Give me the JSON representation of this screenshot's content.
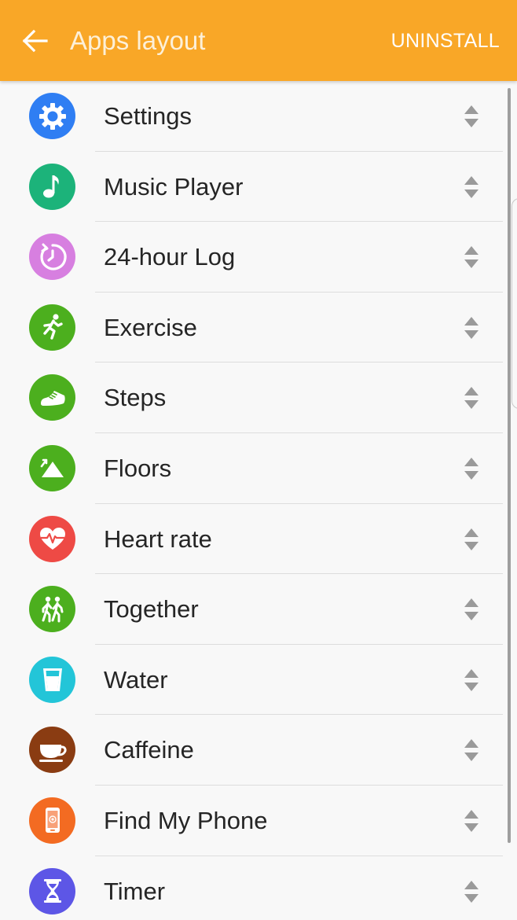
{
  "header": {
    "title": "Apps layout",
    "action_label": "UNINSTALL",
    "back_icon": "arrow-left-icon",
    "background_color": "#f9a727"
  },
  "apps": [
    {
      "label": "Settings",
      "icon": "gear-icon",
      "color": "#2f7ef3"
    },
    {
      "label": "Music Player",
      "icon": "music-note-icon",
      "color": "#1cb37a"
    },
    {
      "label": "24-hour Log",
      "icon": "clock-log-icon",
      "color": "#d77fe0"
    },
    {
      "label": "Exercise",
      "icon": "runner-icon",
      "color": "#4caf1e"
    },
    {
      "label": "Steps",
      "icon": "shoe-icon",
      "color": "#4caf1e"
    },
    {
      "label": "Floors",
      "icon": "mountain-icon",
      "color": "#4caf1e"
    },
    {
      "label": "Heart rate",
      "icon": "heart-pulse-icon",
      "color": "#ee4a45"
    },
    {
      "label": "Together",
      "icon": "walkers-icon",
      "color": "#4caf1e"
    },
    {
      "label": "Water",
      "icon": "glass-icon",
      "color": "#23c5d8"
    },
    {
      "label": "Caffeine",
      "icon": "coffee-cup-icon",
      "color": "#8a3c12"
    },
    {
      "label": "Find My Phone",
      "icon": "phone-icon",
      "color": "#f36b22"
    },
    {
      "label": "Timer",
      "icon": "hourglass-icon",
      "color": "#5d56e6"
    }
  ]
}
